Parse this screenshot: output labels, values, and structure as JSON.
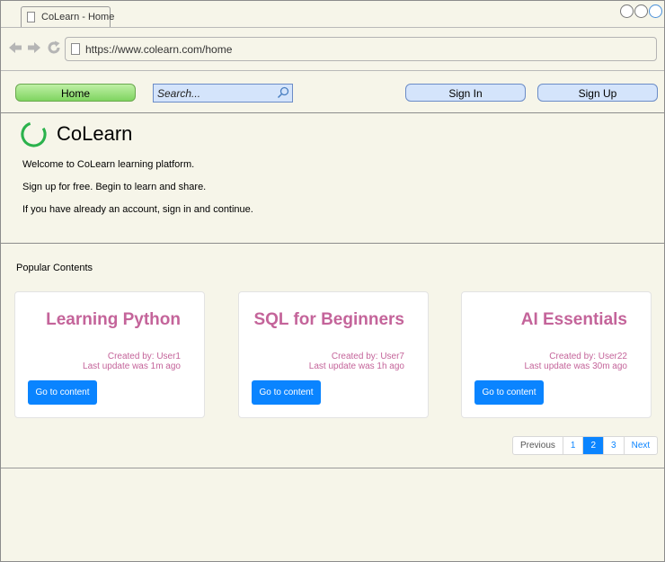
{
  "browser": {
    "tab_title": "CoLearn - Home",
    "url": "https://www.colearn.com/home"
  },
  "toolbar": {
    "home_label": "Home",
    "search_placeholder": "Search...",
    "signin_label": "Sign In",
    "signup_label": "Sign Up"
  },
  "hero": {
    "brand": "CoLearn",
    "line1": "Welcome to CoLearn learning platform.",
    "line2": "Sign up for free. Begin to learn and share.",
    "line3": "If you have already an account, sign in and continue."
  },
  "popular": {
    "title": "Popular Contents",
    "cards": [
      {
        "title": "Learning Python",
        "created": "Created by: User1",
        "updated": "Last update was 1m ago",
        "button": "Go to content"
      },
      {
        "title": "SQL for Beginners",
        "created": "Created by: User7",
        "updated": "Last update was 1h ago",
        "button": "Go to content"
      },
      {
        "title": "AI Essentials",
        "created": "Created by: User22",
        "updated": "Last update was 30m ago",
        "button": "Go to content"
      }
    ]
  },
  "pagination": {
    "previous": "Previous",
    "pages": [
      "1",
      "2",
      "3"
    ],
    "active_page": "2",
    "next": "Next"
  },
  "colors": {
    "accent": "#0a84ff",
    "card_text": "#c4649a",
    "logo": "#2bb24c"
  }
}
